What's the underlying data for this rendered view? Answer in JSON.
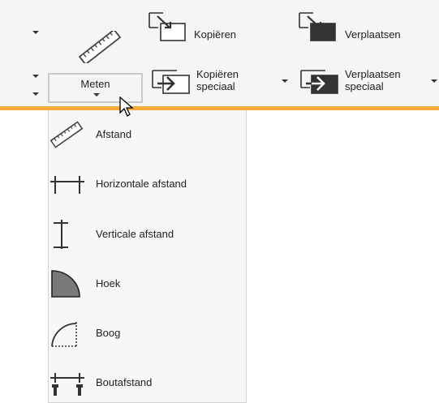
{
  "ribbon": {
    "meten_label": "Meten",
    "kopieren_label": "Kopiëren",
    "kopieren_speciaal_line1": "Kopiëren",
    "kopieren_speciaal_line2": "speciaal",
    "verplaatsen_label": "Verplaatsen",
    "verplaatsen_speciaal_line1": "Verplaatsen",
    "verplaatsen_speciaal_line2": "speciaal"
  },
  "menu": {
    "items": [
      {
        "label": "Afstand",
        "icon": "ruler-icon"
      },
      {
        "label": "Horizontale afstand",
        "icon": "horizontal-dimension-icon"
      },
      {
        "label": "Verticale afstand",
        "icon": "vertical-dimension-icon"
      },
      {
        "label": "Hoek",
        "icon": "angle-icon"
      },
      {
        "label": "Boog",
        "icon": "arc-icon"
      },
      {
        "label": "Boutafstand",
        "icon": "bolt-distance-icon"
      }
    ]
  },
  "colors": {
    "accent": "#f3a93b",
    "ribbon_bg": "#f5f5f5",
    "menu_bg": "#f7f7f7"
  }
}
